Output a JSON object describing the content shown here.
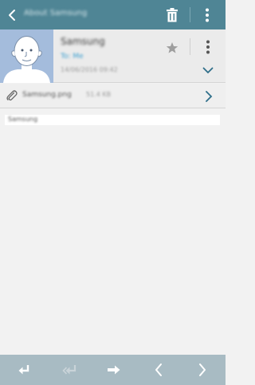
{
  "appbar": {
    "title": "About Samsung",
    "icons": {
      "back": "back-arrow-icon",
      "delete": "trash-icon",
      "more": "more-vert-icon"
    }
  },
  "header": {
    "sender": "Samsung",
    "recipient": "To: Me",
    "datetime": "14/06/2016 09:42",
    "icons": {
      "favorite": "star-icon",
      "more": "more-vert-icon",
      "expand": "chevron-down-icon"
    }
  },
  "attachment": {
    "filename": "Samsung.png",
    "size": "51.4 KB",
    "icons": {
      "attach": "paperclip-icon",
      "open": "chevron-right-icon"
    }
  },
  "body": {
    "text": "Samsung"
  },
  "bottombar": {
    "icons": [
      "reply-icon",
      "reply-all-icon",
      "forward-icon",
      "previous-icon",
      "next-icon"
    ]
  },
  "colors": {
    "appbar": "#4f8595",
    "bottombar": "#a8bbc3",
    "avatar": "#a4bcdc",
    "accent": "#3ea0d0",
    "background": "#f2f2f2"
  }
}
